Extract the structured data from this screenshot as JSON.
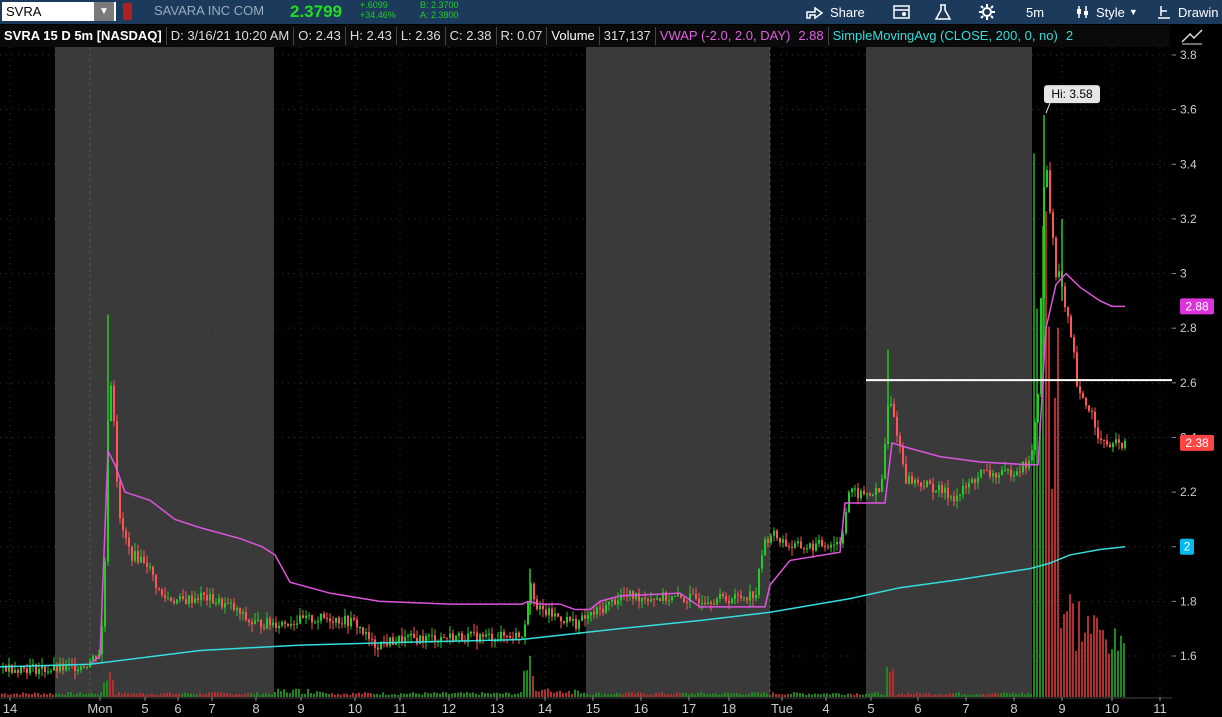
{
  "toolbar": {
    "symbol": "SVRA",
    "company": "SAVARA INC COM",
    "last_price": "2.3799",
    "net_change": "+.6099",
    "pct_change": "+34.46%",
    "bid": "B: 2.3700",
    "ask": "A: 2.3800",
    "share_label": "Share",
    "timeframe_label": "5m",
    "style_label": "Style",
    "drawing_label": "Drawin"
  },
  "info": {
    "title": "SVRA 15 D 5m [NASDAQ]",
    "date": "D: 3/16/21 10:20 AM",
    "open": "O: 2.43",
    "high": "H: 2.43",
    "low": "L: 2.36",
    "close": "C: 2.38",
    "range": "R: 0.07",
    "volume_label": "Volume",
    "volume_value": "317,137",
    "vwap_label": "VWAP (-2.0, 2.0, DAY)",
    "vwap_value": "2.88",
    "sma_label": "SimpleMovingAvg (CLOSE, 200, 0, no)",
    "sma_value": "2"
  },
  "chart_data": {
    "type": "candlestick",
    "ylim": [
      1.45,
      3.8
    ],
    "y_ticks": [
      "3.8",
      "3.6",
      "3.4",
      "3.2",
      "3",
      "2.8",
      "2.6",
      "2.4",
      "2.2",
      "2",
      "1.8",
      "1.6"
    ],
    "x_labels": [
      "14",
      "Mon",
      "5",
      "6",
      "7",
      "8",
      "9",
      "10",
      "11",
      "12",
      "13",
      "14",
      "15",
      "16",
      "17",
      "18",
      "Tue",
      "4",
      "5",
      "6",
      "7",
      "8",
      "9",
      "10",
      "11"
    ],
    "high_marker": "Hi: 3.58",
    "horizontal_line": 2.61,
    "price_badge": "2.38",
    "vwap_badge": "2.88",
    "sma_badge": "2",
    "colors": {
      "up": "#22cc22",
      "down": "#ff5555",
      "vwap": "#dd55dd",
      "sma": "#33dddd",
      "session": "#3a3a3a",
      "price_badge": "#ff4444",
      "vwap_badge": "#dd33dd",
      "sma_badge": "#00bbee"
    }
  }
}
